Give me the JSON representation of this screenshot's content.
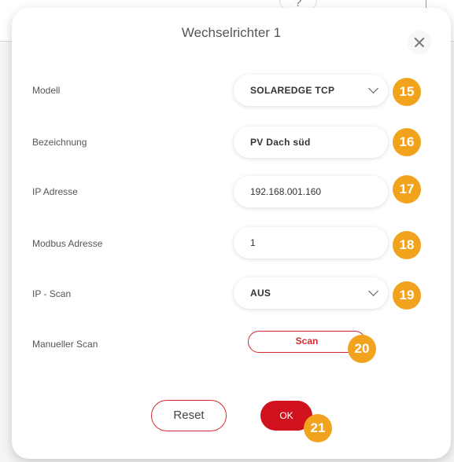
{
  "background": {
    "hint_text": "?"
  },
  "dialog": {
    "title": "Wechselrichter 1",
    "fields": [
      {
        "label": "Modell",
        "value": "SOLAREDGE TCP",
        "type": "select",
        "badge": "15"
      },
      {
        "label": "Bezeichnung",
        "value": "PV Dach süd",
        "type": "text",
        "badge": "16"
      },
      {
        "label": "IP Adresse",
        "value": "192.168.001.160",
        "type": "text",
        "badge": "17"
      },
      {
        "label": "Modbus Adresse",
        "value": "1",
        "type": "text",
        "badge": "18"
      },
      {
        "label": "IP - Scan",
        "value": "AUS",
        "type": "select",
        "badge": "19"
      }
    ],
    "manual_scan": {
      "label": "Manueller Scan",
      "button": "Scan",
      "badge": "20"
    },
    "buttons": {
      "reset": "Reset",
      "ok": "OK",
      "badge": "21"
    }
  },
  "colors": {
    "accent": "#d0121f",
    "badge": "#f2a31e"
  }
}
